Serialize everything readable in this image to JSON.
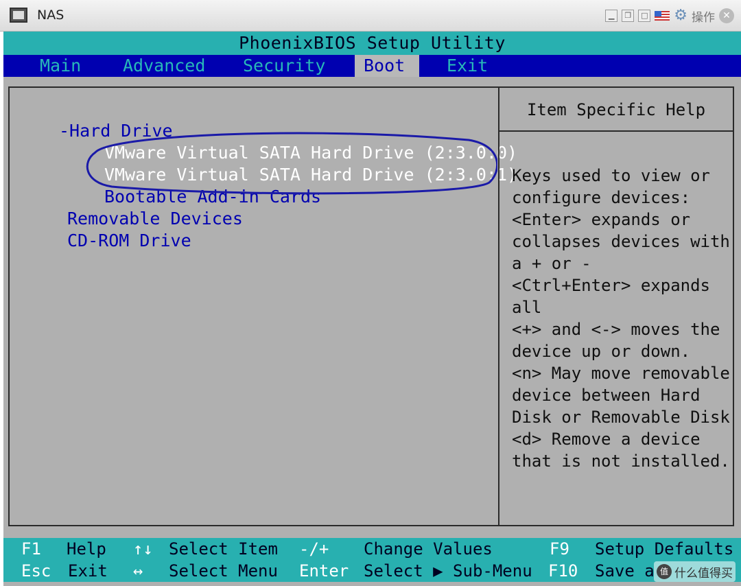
{
  "window": {
    "title": "NAS",
    "ops_label": "操作",
    "controls": [
      "minimize-icon",
      "restore-icon",
      "maximize-icon",
      "flag-icon",
      "gear-icon",
      "close-icon"
    ]
  },
  "bios": {
    "title": "PhoenixBIOS Setup Utility",
    "menu": [
      {
        "label": "Main",
        "active": false
      },
      {
        "label": "Advanced",
        "active": false
      },
      {
        "label": "Security",
        "active": false
      },
      {
        "label": "Boot",
        "active": true
      },
      {
        "label": "Exit",
        "active": false
      }
    ],
    "boot_items": [
      "-Hard Drive",
      "VMware Virtual SATA Hard Drive (2:3.0:0)",
      "VMware Virtual SATA Hard Drive (2:3.0:1)",
      "Bootable Add-in Cards",
      "Removable Devices",
      "CD-ROM Drive"
    ],
    "help": {
      "title": "Item Specific Help",
      "lines": [
        "Keys used to view or",
        "configure devices:",
        "<Enter> expands or",
        "collapses devices with",
        "a + or -",
        "<Ctrl+Enter> expands",
        "all",
        "<+> and <-> moves the",
        "device up or down.",
        "<n> May move removable",
        "device between Hard",
        "Disk or Removable Disk",
        "<d> Remove a device",
        "that is not installed."
      ]
    },
    "footer": {
      "row1": [
        {
          "key": "F1",
          "desc": "Help"
        },
        {
          "key": "↑↓",
          "desc": "Select Item"
        },
        {
          "key": "-/+",
          "desc": "Change Values"
        },
        {
          "key": "F9",
          "desc": "Setup Defaults"
        }
      ],
      "row2": [
        {
          "key": "Esc",
          "desc": "Exit"
        },
        {
          "key": "↔",
          "desc": "Select Menu"
        },
        {
          "key": "Enter",
          "desc": "Select ▶ Sub-Menu"
        },
        {
          "key": "F10",
          "desc": "Save a"
        }
      ]
    },
    "colors": {
      "cyan": "#28b0b0",
      "blue": "#0000b0",
      "panel_gray": "#b0b0b0",
      "highlight_text": "#ffffff",
      "annotation": "#1a1aa8"
    }
  },
  "watermark": {
    "logo_text": "值",
    "text": "什么值得买"
  }
}
